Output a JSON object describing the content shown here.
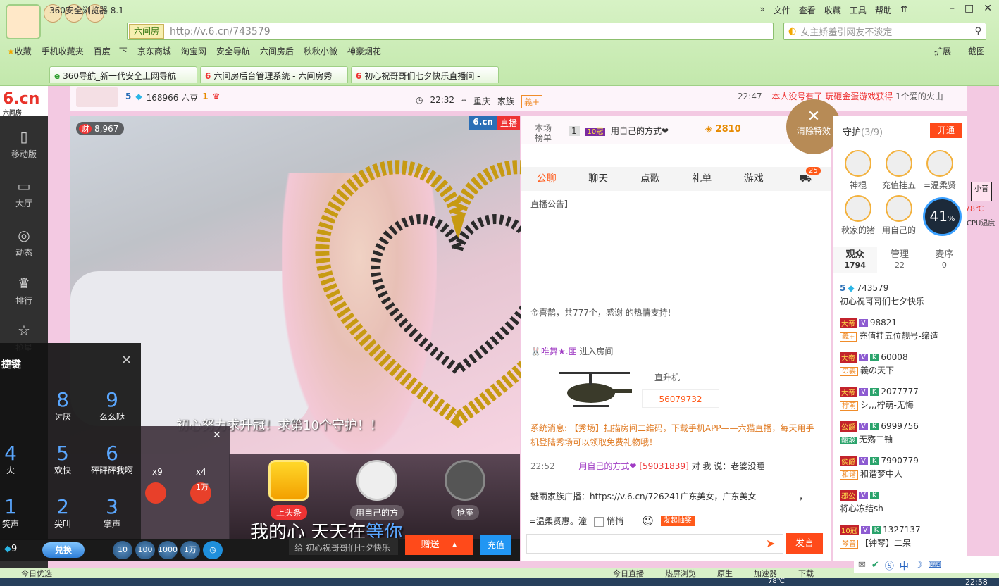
{
  "browser": {
    "title": "360安全浏览器 8.1",
    "menu": [
      "文件",
      "查看",
      "收藏",
      "工具",
      "帮助"
    ],
    "site_tag": "六间房",
    "url": "http://v.6.cn/743579",
    "search_placeholder": "女主娇羞引网友不淡定",
    "favorites": [
      "收藏",
      "手机收藏夹",
      "百度一下",
      "京东商城",
      "淘宝网",
      "安全导航",
      "六间房后",
      "秋秋小黴",
      "神豪烟花"
    ],
    "fav_right": [
      "扩展",
      "截图"
    ],
    "tabs": [
      "360导航_新一代安全上网导航",
      "六间房后台管理系统 - 六间房秀",
      "初心祝哥哥们七夕快乐直播间 -"
    ]
  },
  "leftnav": {
    "logo": "6.cn",
    "logo_sub": "六间房",
    "items": [
      "移动版",
      "大厅",
      "动态",
      "排行",
      "抢星"
    ]
  },
  "topstrip": {
    "host_level": "5",
    "host_beans": "168966 六豆",
    "host_rank": "1",
    "time": "22:32",
    "city": "重庆",
    "family": "家族",
    "family_badge": "義+",
    "broadcast_time": "22:47",
    "broadcast_red": "本人没号有了 玩砸金蛋游戏获得",
    "broadcast_rest": "1个爱的火山"
  },
  "video": {
    "wealth_icon": "财",
    "wealth": "8,967",
    "brand": "6.cn",
    "live": "直播",
    "marquee": "初心努力求升冠！求第10个守护！！",
    "lyrics_a": "我的心 天天在",
    "lyrics_b": "等你",
    "stage": [
      "上头条",
      "用自己的方",
      "抢座"
    ]
  },
  "giftbar": {
    "count": "9",
    "exchange": "兑换",
    "quantities": [
      "10",
      "100",
      "1000",
      "1万"
    ],
    "to": "给  初心祝哥哥们七夕快乐",
    "send": "赠送",
    "charge": "充值"
  },
  "shortcut": {
    "title": "捷键",
    "keys": [
      {
        "num": "8",
        "txt": "讨厌"
      },
      {
        "num": "9",
        "txt": "么么哒"
      },
      {
        "num": "4",
        "txt": "火"
      },
      {
        "num": "5",
        "txt": "欢快"
      },
      {
        "num": "6",
        "txt": "砰砰砰我啊"
      },
      {
        "num": "1",
        "txt": "笑声"
      },
      {
        "num": "2",
        "txt": "尖叫"
      },
      {
        "num": "3",
        "txt": "掌声"
      }
    ],
    "popup_x9": "x9",
    "popup_x4": "x4",
    "popup_10k": "1万"
  },
  "chat": {
    "rank_label": "本场榜单",
    "rank_no": "1",
    "rank_level": "10冠",
    "rank_user": "用自己的方式❤",
    "rank_gold": "2810",
    "tabs": [
      "公聊",
      "聊天",
      "点歌",
      "礼单",
      "游戏"
    ],
    "car_count": "25",
    "announce": "直播公告】",
    "gift_msg": "金喜鹊，共777个，感谢",
    "gift_msg2": "的热情支持!",
    "enter_nick": "🐰唯舞★.匪",
    "enter_text": "进入房间",
    "heli_label": "直升机",
    "heli_num": "56079732",
    "sys_msg": "系统消息: 【秀场】扫描房间二维码，下载手机APP——六猫直播，每天用手机登陆秀场可以领取免费礼物哦！",
    "chat_time": "22:52",
    "chat_nick": "用自己的方式❤",
    "chat_id": "[59031839]",
    "chat_to": "对 我 说：老婆没睡",
    "family_msg": "魅雨家族广播：https://v.6.cn/726241广东美女，广东美女--------------，",
    "whisper_to": "=温柔贤惠。潼",
    "whisper": "悄悄",
    "lottery": "发起抽奖",
    "send": "发言"
  },
  "clear_fx": "清除特效",
  "guard": {
    "title": "守护",
    "count": "(3/9)",
    "open": "开通",
    "members": [
      "神棍",
      "充值挂五",
      "=温柔贤",
      "秋家的猪",
      "用自己的"
    ]
  },
  "audience": {
    "tabs": [
      {
        "label": "观众",
        "n": "1794"
      },
      {
        "label": "管理",
        "n": "22"
      },
      {
        "label": "麦序",
        "n": "0"
      }
    ],
    "list": [
      {
        "badge": "5",
        "id": "743579",
        "name": "初心祝哥哥们七夕快乐",
        "fam": ""
      },
      {
        "badge": "大帝",
        "id": "98821",
        "name": "充值挂五位靓号-缔造",
        "fam": "義+"
      },
      {
        "badge": "大帝",
        "id": "60008",
        "name": "義の天下",
        "fam": "の義"
      },
      {
        "badge": "大帝",
        "id": "2077777",
        "name": "シ,,,柠萌-无悔",
        "fam": "柠萌"
      },
      {
        "badge": "公爵",
        "id": "6999756",
        "name": "无殇二铀",
        "fam": "翻滚"
      },
      {
        "badge": "侯爵",
        "id": "7990779",
        "name": "和谐梦中人",
        "fam": "和谐"
      },
      {
        "badge": "郡公",
        "id": "",
        "name": "将心冻结sh",
        "fam": ""
      },
      {
        "badge": "10冠",
        "id": "1327137",
        "name": "【钟琴】二呆",
        "fam": "琴音"
      }
    ]
  },
  "cpu": {
    "percent": "41",
    "unit": "%",
    "temp": "78℃",
    "label": "CPU温度"
  },
  "side_girl": "小音",
  "statusbar": {
    "left": "今日优选",
    "right": [
      "今日直播",
      "热屏浏览",
      "原生",
      "加速器",
      "下载"
    ],
    "tray": "中",
    "clock": "22:58",
    "temp": "78℃"
  }
}
